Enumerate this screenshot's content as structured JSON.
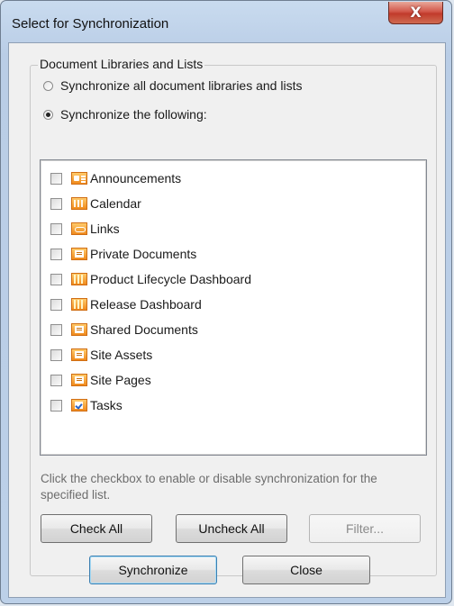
{
  "window": {
    "title": "Select for Synchronization",
    "close_glyph": "X"
  },
  "group": {
    "legend": "Document Libraries and Lists",
    "options": [
      {
        "label": "Synchronize all document libraries and lists",
        "checked": false
      },
      {
        "label": "Synchronize the following:",
        "checked": true
      }
    ]
  },
  "list": {
    "items": [
      {
        "label": "Announcements",
        "icon": "announcements-icon",
        "checked": false
      },
      {
        "label": "Calendar",
        "icon": "calendar-icon",
        "checked": false
      },
      {
        "label": "Links",
        "icon": "links-icon",
        "checked": false
      },
      {
        "label": "Private Documents",
        "icon": "document-library-icon",
        "checked": false
      },
      {
        "label": "Product Lifecycle Dashboard",
        "icon": "dashboard-icon",
        "checked": false
      },
      {
        "label": "Release Dashboard",
        "icon": "dashboard-icon",
        "checked": false
      },
      {
        "label": "Shared Documents",
        "icon": "document-library-icon",
        "checked": false
      },
      {
        "label": "Site Assets",
        "icon": "document-library-icon",
        "checked": false
      },
      {
        "label": "Site Pages",
        "icon": "document-library-icon",
        "checked": false
      },
      {
        "label": "Tasks",
        "icon": "tasks-icon",
        "checked": false
      }
    ]
  },
  "hint": "Click the checkbox to enable or disable synchronization for the specified list.",
  "buttons": {
    "check_all": "Check All",
    "uncheck_all": "Uncheck All",
    "filter": "Filter...",
    "synchronize": "Synchronize",
    "close": "Close"
  },
  "colors": {
    "accent_orange": "#f08a1c",
    "frame_blue": "#bcd0e8",
    "close_red": "#c13b2b"
  }
}
